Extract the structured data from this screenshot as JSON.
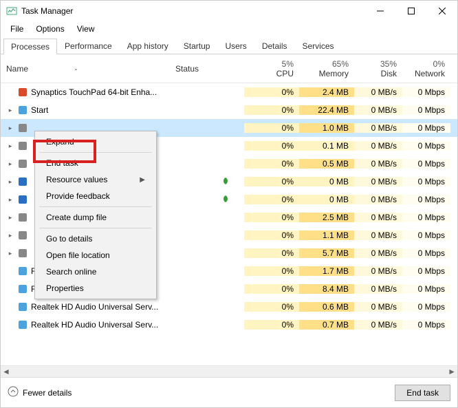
{
  "window": {
    "title": "Task Manager"
  },
  "menubar": [
    "File",
    "Options",
    "View"
  ],
  "tabs": [
    "Processes",
    "Performance",
    "App history",
    "Startup",
    "Users",
    "Details",
    "Services"
  ],
  "active_tab": "Processes",
  "columns": {
    "name": "Name",
    "status": "Status",
    "cpu": {
      "pct": "5%",
      "label": "CPU"
    },
    "memory": {
      "pct": "65%",
      "label": "Memory"
    },
    "disk": {
      "pct": "35%",
      "label": "Disk"
    },
    "network": {
      "pct": "0%",
      "label": "Network"
    }
  },
  "rows": [
    {
      "name": "Synaptics TouchPad 64-bit Enha...",
      "cpu": "0%",
      "mem": "2.4 MB",
      "disk": "0 MB/s",
      "net": "0 Mbps",
      "expandable": false,
      "icon": "#d94b2a"
    },
    {
      "name": "Start",
      "cpu": "0%",
      "mem": "22.4 MB",
      "disk": "0 MB/s",
      "net": "0 Mbps",
      "expandable": true,
      "icon": "#4aa3df"
    },
    {
      "name": "",
      "cpu": "0%",
      "mem": "1.0 MB",
      "disk": "0 MB/s",
      "net": "0 Mbps",
      "expandable": true,
      "icon": "#888",
      "selected": true
    },
    {
      "name": "",
      "cpu": "0%",
      "mem": "0.1 MB",
      "disk": "0 MB/s",
      "net": "0 Mbps",
      "expandable": true,
      "icon": "#888",
      "mem0": true
    },
    {
      "name": "",
      "cpu": "0%",
      "mem": "0.5 MB",
      "disk": "0 MB/s",
      "net": "0 Mbps",
      "expandable": true,
      "icon": "#888"
    },
    {
      "name": "",
      "cpu": "0%",
      "mem": "0 MB",
      "disk": "0 MB/s",
      "net": "0 Mbps",
      "expandable": true,
      "icon": "#2a70c2",
      "leaf": "green",
      "mem0": true
    },
    {
      "name": "",
      "cpu": "0%",
      "mem": "0 MB",
      "disk": "0 MB/s",
      "net": "0 Mbps",
      "expandable": true,
      "icon": "#2a70c2",
      "leaf": "green",
      "mem0": true
    },
    {
      "name": "",
      "cpu": "0%",
      "mem": "2.5 MB",
      "disk": "0 MB/s",
      "net": "0 Mbps",
      "expandable": true,
      "icon": "#888"
    },
    {
      "name": "",
      "cpu": "0%",
      "mem": "1.1 MB",
      "disk": "0 MB/s",
      "net": "0 Mbps",
      "expandable": true,
      "icon": "#888"
    },
    {
      "name": "",
      "cpu": "0%",
      "mem": "5.7 MB",
      "disk": "0 MB/s",
      "net": "0 Mbps",
      "expandable": true,
      "icon": "#888"
    },
    {
      "name": "Runtime Broker",
      "cpu": "0%",
      "mem": "1.7 MB",
      "disk": "0 MB/s",
      "net": "0 Mbps",
      "expandable": false,
      "icon": "#4aa3df"
    },
    {
      "name": "Runtime Broker",
      "cpu": "0%",
      "mem": "8.4 MB",
      "disk": "0 MB/s",
      "net": "0 Mbps",
      "expandable": false,
      "icon": "#4aa3df"
    },
    {
      "name": "Realtek HD Audio Universal Serv...",
      "cpu": "0%",
      "mem": "0.6 MB",
      "disk": "0 MB/s",
      "net": "0 Mbps",
      "expandable": false,
      "icon": "#4aa3df"
    },
    {
      "name": "Realtek HD Audio Universal Serv...",
      "cpu": "0%",
      "mem": "0.7 MB",
      "disk": "0 MB/s",
      "net": "0 Mbps",
      "expandable": false,
      "icon": "#4aa3df"
    }
  ],
  "context_menu": {
    "expand": "Expand",
    "end_task": "End task",
    "resource_values": "Resource values",
    "provide_feedback": "Provide feedback",
    "create_dump": "Create dump file",
    "go_to_details": "Go to details",
    "open_file_location": "Open file location",
    "search_online": "Search online",
    "properties": "Properties"
  },
  "footer": {
    "fewer_details": "Fewer details",
    "end_task": "End task"
  }
}
